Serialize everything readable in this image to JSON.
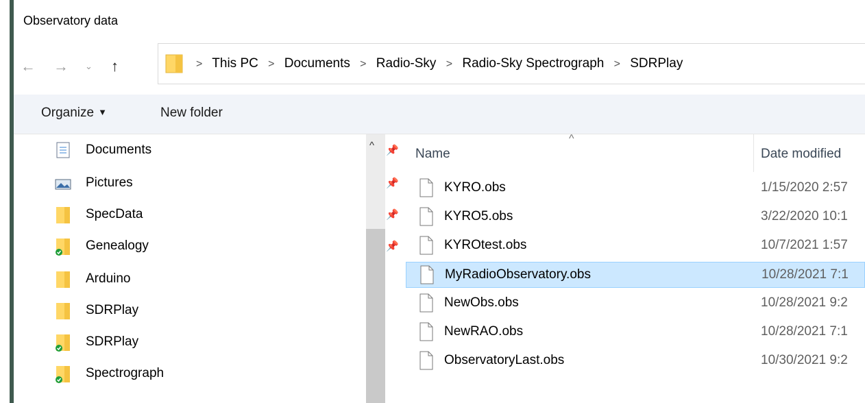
{
  "window": {
    "title": "Observatory data"
  },
  "nav": {
    "back_icon": "arrow-left",
    "forward_icon": "arrow-right",
    "recent_icon": "chevron-down",
    "up_icon": "arrow-up",
    "breadcrumbs": [
      "This PC",
      "Documents",
      "Radio-Sky",
      "Radio-Sky Spectrograph",
      "SDRPlay"
    ]
  },
  "toolbar": {
    "organize_label": "Organize",
    "new_folder_label": "New folder"
  },
  "tree": {
    "items": [
      {
        "label": "Documents",
        "icon": "documents-icon",
        "pinned": true
      },
      {
        "label": "Pictures",
        "icon": "pictures-icon",
        "pinned": true
      },
      {
        "label": "SpecData",
        "icon": "folder-icon",
        "pinned": true
      },
      {
        "label": "Genealogy",
        "icon": "folder-synced-icon",
        "pinned": true
      },
      {
        "label": "Arduino",
        "icon": "folder-icon",
        "pinned": false
      },
      {
        "label": "SDRPlay",
        "icon": "folder-icon",
        "pinned": false
      },
      {
        "label": "SDRPlay",
        "icon": "folder-synced-icon",
        "pinned": false
      },
      {
        "label": "Spectrograph",
        "icon": "folder-synced-icon",
        "pinned": false
      }
    ]
  },
  "files": {
    "columns": {
      "name": "Name",
      "date": "Date modified"
    },
    "rows": [
      {
        "name": "KYRO.obs",
        "date": "1/15/2020 2:57",
        "selected": false
      },
      {
        "name": "KYRO5.obs",
        "date": "3/22/2020 10:1",
        "selected": false
      },
      {
        "name": "KYROtest.obs",
        "date": "10/7/2021 1:57",
        "selected": false
      },
      {
        "name": "MyRadioObservatory.obs",
        "date": "10/28/2021 7:1",
        "selected": true
      },
      {
        "name": "NewObs.obs",
        "date": "10/28/2021 9:2",
        "selected": false
      },
      {
        "name": "NewRAO.obs",
        "date": "10/28/2021 7:1",
        "selected": false
      },
      {
        "name": "ObservatoryLast.obs",
        "date": "10/30/2021 9:2",
        "selected": false
      }
    ]
  },
  "colors": {
    "selection": "#cce8ff",
    "toolbar_bg": "#f1f4f9",
    "folder": "#ffd766"
  }
}
